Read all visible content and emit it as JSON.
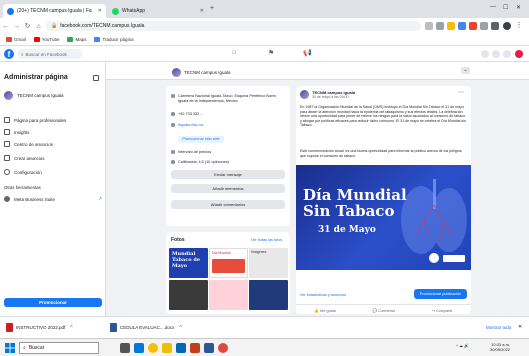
{
  "browser": {
    "tabs": [
      {
        "label": "(20+) TECNM campus Iguala | Fa",
        "active": true,
        "favicon_color": "#1877f2"
      },
      {
        "label": "WhatsApp",
        "active": false,
        "favicon_color": "#25d366"
      }
    ],
    "new_tab": "+",
    "url": "facebook.com/TECNM.campus.Iguala",
    "bookmarks": [
      "Gmail",
      "YouTube",
      "Maps",
      "Traducir página"
    ]
  },
  "fb": {
    "search_placeholder": "Buscar en Facebook"
  },
  "left_panel": {
    "title": "Administrar página",
    "page_name": "TECNM campus Iguala",
    "items": [
      "Página para profesionales",
      "Insights",
      "Centro de anuncios",
      "Crear anuncios",
      "Configuración"
    ],
    "section_label": "Otras herramientas",
    "meta_suite": "Meta Business Suite",
    "promote_button": "Promocionar"
  },
  "page_header": {
    "name": "TECNM campus Iguala",
    "more": "⌄"
  },
  "about": {
    "address": "Carretera Nacional Iguala-Taxco, Esquina Periférico Norte, Iguala de la Independencia, Mexico",
    "phone": "+52 733 332 ...",
    "link": "itiguala.edu.mx",
    "promote_label": "Promocionar sitio web",
    "price_label": "Intervalo de precios",
    "rating": "Calificación 4.5 (10 opiniones)",
    "btn_tour": "Enviar mensaje",
    "btn_albums": "Añadir elementos",
    "btn_contact": "Añadir comentarios"
  },
  "photos": {
    "title": "Fotos",
    "see_all": "Ver todas las fotos",
    "thumbs": [
      "Mundial Tabaco de Mayo",
      "Día Mundial",
      "Imágenes"
    ]
  },
  "post": {
    "page_name": "TECNM campus Iguala",
    "date": "30 de mayo a las 09:00 ·",
    "body": "En 1987 la Organización Mundial de la Salud (OMS) instituyó el Día Mundial Sin Tabaco el 31 de mayo para atraer la atención mundial hacia la epidemia del tabaquismo y sus efectos letales. La celebración ofrece una oportunidad para poner de relieve los riesgos para la salud asociados al consumo de tabaco y abogar por políticas eficaces para reducir dicho consumo. El 31 de mayo se celebra el Día Mundial sin Tabaco.",
    "body2": "Este conmemoración anual, es una buena oportunidad para informar al público acerca de los peligros que supone el consumo de tabaco.",
    "banner_line1": "Día Mundial",
    "banner_line2": "Sin Tabaco",
    "banner_date": "31 de Mayo",
    "insights": "Ver estadísticas y anuncios",
    "boost": "Promocionar publicación",
    "actions": [
      "Me gusta",
      "Comentar",
      "Compartir"
    ]
  },
  "downloads": [
    {
      "name": "INSTRUCTIVO 2022.pdf",
      "type": "pdf"
    },
    {
      "name": "CEDULA EVALUAC....docx",
      "type": "word"
    }
  ],
  "downloads_show_all": "Mostrar todo",
  "taskbar": {
    "search_label": "Buscar",
    "time": "10:33 a.m.",
    "date": "30/05/2022"
  }
}
